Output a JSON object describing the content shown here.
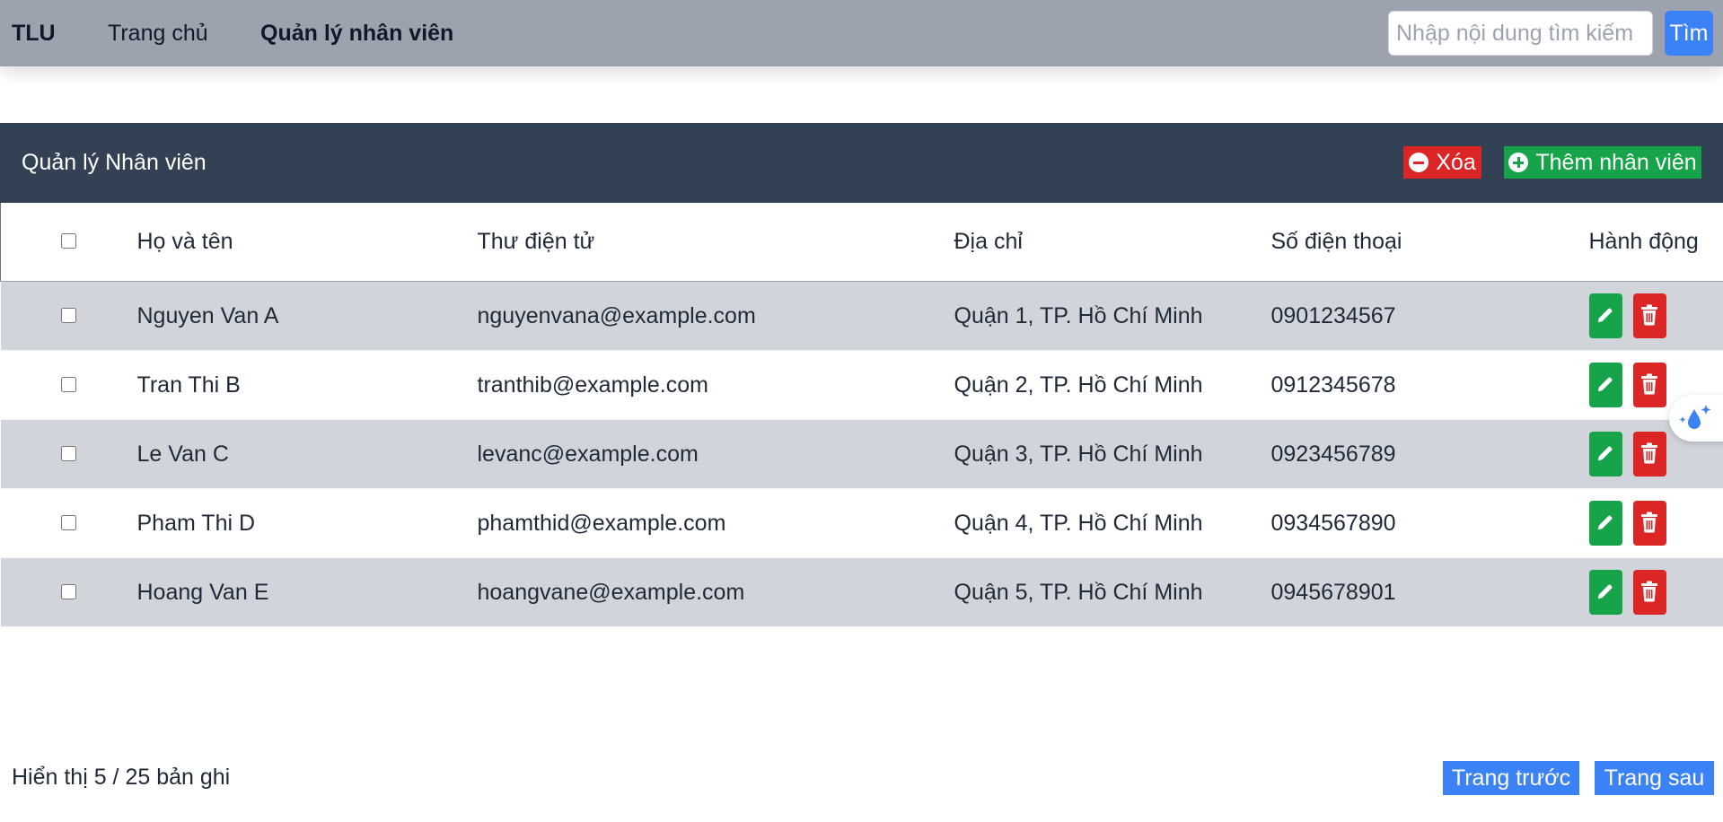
{
  "navbar": {
    "brand": "TLU",
    "links": [
      "Trang chủ",
      "Quản lý nhân viên"
    ],
    "search_placeholder": "Nhập nội dung tìm kiếm",
    "search_button": "Tìm"
  },
  "panel": {
    "title": "Quản lý Nhân viên",
    "delete_label": "Xóa",
    "add_label": "Thêm nhân viên"
  },
  "table": {
    "headers": [
      "Họ và tên",
      "Thư điện tử",
      "Địa chỉ",
      "Số điện thoại",
      "Hành động"
    ],
    "rows": [
      {
        "name": "Nguyen Van A",
        "email": "nguyenvana@example.com",
        "address": "Quận 1, TP. Hồ Chí Minh",
        "phone": "0901234567"
      },
      {
        "name": "Tran Thi B",
        "email": "tranthib@example.com",
        "address": "Quận 2, TP. Hồ Chí Minh",
        "phone": "0912345678"
      },
      {
        "name": "Le Van C",
        "email": "levanc@example.com",
        "address": "Quận 3, TP. Hồ Chí Minh",
        "phone": "0923456789"
      },
      {
        "name": "Pham Thi D",
        "email": "phamthid@example.com",
        "address": "Quận 4, TP. Hồ Chí Minh",
        "phone": "0934567890"
      },
      {
        "name": "Hoang Van E",
        "email": "hoangvane@example.com",
        "address": "Quận 5, TP. Hồ Chí Minh",
        "phone": "0945678901"
      }
    ]
  },
  "footer": {
    "info": "Hiển thị 5 / 25 bản ghi",
    "prev_label": "Trang trước",
    "next_label": "Trang sau"
  },
  "colors": {
    "navbar_bg": "#9ca3af",
    "header_bg": "#334155",
    "primary": "#3b82f6",
    "success": "#16a34a",
    "danger": "#dc2626",
    "row_alt": "#d1d5db"
  },
  "icons": {
    "edit": "pencil-icon",
    "delete": "trash-icon",
    "remove": "minus-circle-icon",
    "add": "plus-circle-icon",
    "widget": "water-drop-sparkle-icon"
  }
}
